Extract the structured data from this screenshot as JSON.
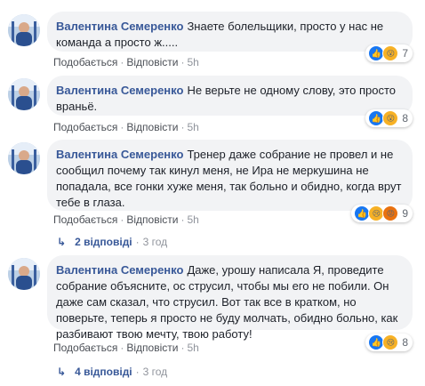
{
  "comments": [
    {
      "author": "Валентина Семеренко",
      "text": "Знаете болельщики, просто у нас не команда а просто ж.....",
      "like_label": "Подобається",
      "reply_label": "Відповісти",
      "separator": "·",
      "time": "5h",
      "reaction_count": "7",
      "reactions": [
        "like-icon",
        "wow-icon"
      ]
    },
    {
      "author": "Валентина Семеренко",
      "text": "Не верьте не одному слову, это просто враньё.",
      "like_label": "Подобається",
      "reply_label": "Відповісти",
      "separator": "·",
      "time": "5h",
      "reaction_count": "8",
      "reactions": [
        "like-icon",
        "wow-icon"
      ]
    },
    {
      "author": "Валентина Семеренко",
      "text": "Тренер даже собрание не провел и не сообщил почему так кинул меня, не Ира не меркушина не попадала, все гонки хуже меня, так больно и обидно, когда врут тебе в глаза.",
      "like_label": "Подобається",
      "reply_label": "Відповісти",
      "separator": "·",
      "time": "5h",
      "reaction_count": "9",
      "reactions": [
        "like-icon",
        "sad-icon",
        "angry-icon"
      ],
      "replies_label": "2 відповіді",
      "replies_time": "3 год"
    },
    {
      "author": "Валентина Семеренко",
      "text": "Даже, урошу написала Я, проведите собрание объясните, ос струсил, чтобы мы его не побили. Он даже сам сказал, что струсил. Вот так все в кратком, но поверьте, теперь я просто не буду молчать, обидно больно, как разбивают твою мечту, твою работу!",
      "like_label": "Подобається",
      "reply_label": "Відповісти",
      "separator": "·",
      "time": "5h",
      "reaction_count": "8",
      "reactions": [
        "like-icon",
        "sad-icon"
      ],
      "replies_label": "4 відповіді",
      "replies_time": "3 год"
    }
  ],
  "colors": {
    "author": "#385898",
    "bubble": "#f2f3f5",
    "like": "#1877f2",
    "wow": "#f7b125",
    "angry": "#e9710f"
  }
}
